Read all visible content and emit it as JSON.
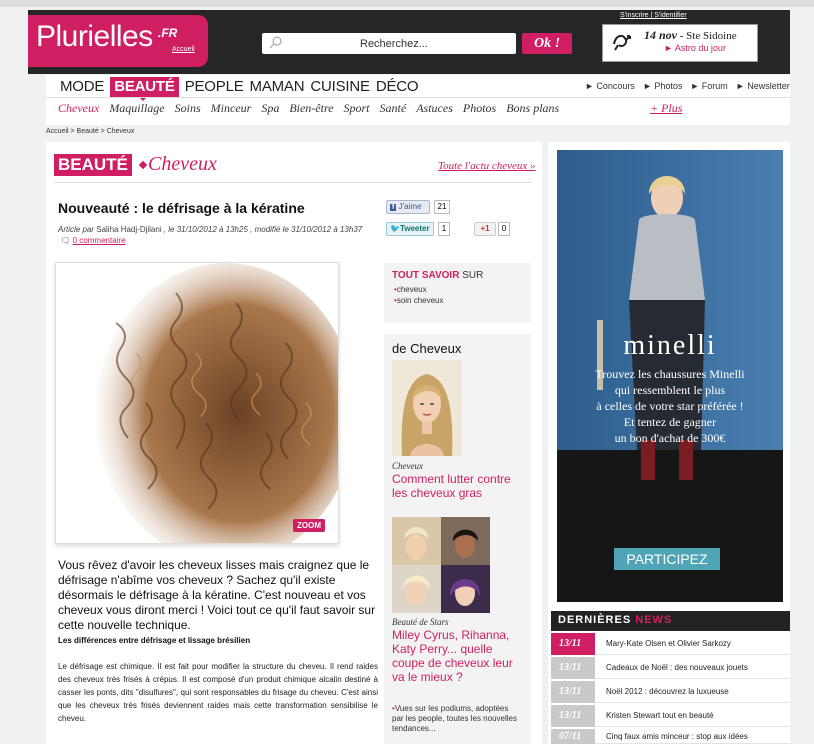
{
  "header": {
    "logo": "Plurielles",
    "logo_fr": ".FR",
    "logo_accueil": "Accueil",
    "login": "S'inscrire | S'identifier",
    "search_placeholder": "Recherchez...",
    "ok_label": "Ok !",
    "astro_date": "14 nov",
    "astro_saint": " - Ste Sidoine",
    "astro_link": "► Astro du jour"
  },
  "main_nav": [
    "MODE",
    "BEAUTÉ",
    "PEOPLE",
    "MAMAN",
    "CUISINE",
    "DÉCO"
  ],
  "active_nav": "BEAUTÉ",
  "util_links": [
    "► Concours",
    "► Photos",
    "► Forum",
    "► Newsletter"
  ],
  "sub_nav": [
    "Cheveux",
    "Maquillage",
    "Soins",
    "Minceur",
    "Spa",
    "Bien-être",
    "Sport",
    "Santé",
    "Astuces",
    "Photos",
    "Bons plans"
  ],
  "sub_plus": "+ Plus",
  "breadcrumb": "Accueil > Beauté > Cheveux",
  "section": {
    "tag": "BEAUTÉ",
    "category": "Cheveux",
    "all_link": "Toute l'actu cheveux »"
  },
  "article": {
    "title": "Nouveauté : le défrisage à la kératine",
    "byline_prefix": "Article par ",
    "author": "Saliha Hadj-Djilani",
    "byline_dates": " , le 31/10/2012 à 13h25 , modifié le 31/10/2012 à 13h37",
    "comment_link": "0 commentaire",
    "zoom": "ZOOM",
    "intro": "Vous rêvez d'avoir les cheveux lisses mais craignez que le défrisage n'abîme vos cheveux ? Sachez qu'il existe désormais le défrisage à la kératine. C'est nouveau et vos cheveux vous diront merci ! Voici tout ce qu'il faut savoir sur cette nouvelle technique.",
    "subhead": "Les différences entre défrisage et lissage brésilien",
    "body": "Le défrisage est chimique. Il est fait pour modifier la structure du cheveu. Il rend raides des cheveux très frisés à crépus. Il est composé d'un produit chimique alcalin destiné à casser les ponts, dits \"disulfures\", qui sont responsables du frisage du cheveu. C'est ainsi que les cheveux très frisés deviennent raides mais cette transformation sensibilise le cheveu."
  },
  "social": {
    "fb_label": "J'aime",
    "fb_count": "21",
    "tw_label": "Tweeter",
    "tw_count": "1",
    "gp_label": "+1",
    "gp_count": "0"
  },
  "tout_savoir": {
    "title_bold": "TOUT SAVOIR",
    "title_rest": " SUR",
    "items": [
      "cheveux",
      "soin cheveux"
    ]
  },
  "de_cheveux": {
    "title": "de Cheveux",
    "cat1": "Cheveux",
    "link1": "Comment lutter contre les cheveux gras",
    "cat2": "Beauté de Stars",
    "link2": "Miley Cyrus, Rihanna, Katy Perry... quelle coupe de cheveux leur va le mieux ?",
    "bullet": "Vues sur les podiums, adoptées par les people, toutes les nouvelles tendances..."
  },
  "ad": {
    "brand": "minelli",
    "text1": "Trouvez les chaussures Minelli",
    "text2": "qui ressemblent le plus",
    "text3": "à celles de votre star préférée !",
    "text4": "Et tentez de gagner",
    "text5": "un bon d'achat de 300€",
    "button": "PARTICIPEZ"
  },
  "news": {
    "title_a": "DERNIÈRES ",
    "title_b": "NEWS",
    "items": [
      {
        "date": "13/11",
        "text": "Mary-Kate Olsen et Olivier Sarkozy"
      },
      {
        "date": "13/11",
        "text": "Cadeaux de Noël : des nouveaux jouets"
      },
      {
        "date": "13/11",
        "text": "Noël 2012 : découvrez la luxueuse"
      },
      {
        "date": "13/11",
        "text": "Kristen Stewart tout en beauté"
      },
      {
        "date": "07/11",
        "text": "Cinq faux amis minceur : stop aux idées"
      }
    ]
  },
  "colors": {
    "brand": "#cf1f62",
    "header": "#262626"
  }
}
